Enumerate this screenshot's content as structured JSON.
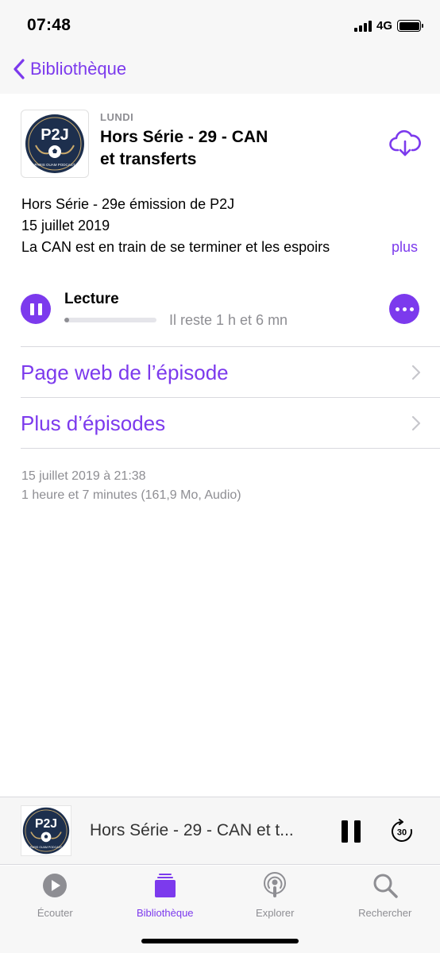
{
  "status_bar": {
    "time": "07:48",
    "network": "4G"
  },
  "nav": {
    "back_label": "Bibliothèque"
  },
  "episode": {
    "day": "LUNDI",
    "title_line1": "Hors Série - 29 - CAN",
    "title_line2": "et transferts",
    "artwork_text": "P2J",
    "artwork_subtext": "PARIS OUAM PODCAST"
  },
  "description": {
    "line1": "Hors Série - 29e émission de P2J",
    "line2": "15 juillet 2019",
    "line3": "La CAN  est en train de se terminer et les espoirs",
    "more_label": "plus"
  },
  "playback": {
    "label": "Lecture",
    "remaining": "Il reste 1 h et 6 mn",
    "progress": 0.05
  },
  "links": [
    {
      "label": "Page web de l’épisode"
    },
    {
      "label": "Plus d’épisodes"
    }
  ],
  "info": {
    "date": "15 juillet 2019 à 21:38",
    "details": "1 heure et 7 minutes (161,9 Mo, Audio)"
  },
  "mini_player": {
    "title": "Hors Série - 29 - CAN et t...",
    "skip_seconds": "30"
  },
  "tabs": [
    {
      "label": "Écouter",
      "icon": "play-circle-icon",
      "active": false
    },
    {
      "label": "Bibliothèque",
      "icon": "library-icon",
      "active": true
    },
    {
      "label": "Explorer",
      "icon": "podcast-icon",
      "active": false
    },
    {
      "label": "Rechercher",
      "icon": "search-icon",
      "active": false
    }
  ],
  "colors": {
    "accent": "#7c3aed",
    "secondary_text": "#8e8e93",
    "artwork_navy": "#1d2f4d"
  }
}
